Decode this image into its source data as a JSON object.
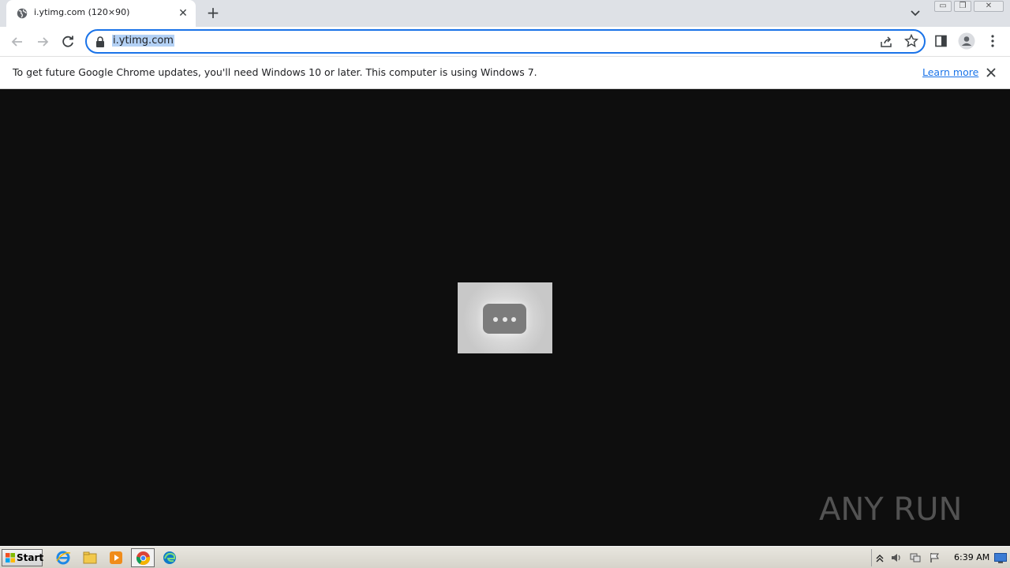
{
  "browser": {
    "tab": {
      "title": "i.ytimg.com (120×90)",
      "close_glyph": "✕"
    },
    "new_tab_glyph": "+",
    "window_controls": {
      "minimize": "▭",
      "restore": "❐",
      "close": "✕"
    },
    "omnibox": {
      "url": "i.ytimg.com"
    },
    "infobar": {
      "message": "To get future Google Chrome updates, you'll need Windows 10 or later. This computer is using Windows 7.",
      "link": "Learn more"
    }
  },
  "content": {
    "watermark": "ANY RUN"
  },
  "taskbar": {
    "start_label": "Start",
    "clock": "6:39 AM",
    "pinned": [
      "internet-explorer-icon",
      "file-explorer-icon",
      "media-player-icon",
      "chrome-icon",
      "edge-icon"
    ]
  },
  "colors": {
    "accent": "#1a73e8",
    "page_background": "#0e0e0e",
    "tab_strip": "#dee1e6"
  }
}
